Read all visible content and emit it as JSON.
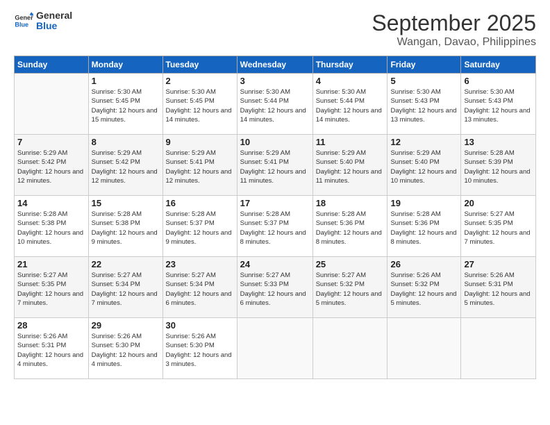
{
  "logo": {
    "line1": "General",
    "line2": "Blue"
  },
  "header": {
    "month": "September 2025",
    "location": "Wangan, Davao, Philippines"
  },
  "weekdays": [
    "Sunday",
    "Monday",
    "Tuesday",
    "Wednesday",
    "Thursday",
    "Friday",
    "Saturday"
  ],
  "weeks": [
    [
      {
        "day": "",
        "info": ""
      },
      {
        "day": "1",
        "info": "Sunrise: 5:30 AM\nSunset: 5:45 PM\nDaylight: 12 hours\nand 15 minutes."
      },
      {
        "day": "2",
        "info": "Sunrise: 5:30 AM\nSunset: 5:45 PM\nDaylight: 12 hours\nand 14 minutes."
      },
      {
        "day": "3",
        "info": "Sunrise: 5:30 AM\nSunset: 5:44 PM\nDaylight: 12 hours\nand 14 minutes."
      },
      {
        "day": "4",
        "info": "Sunrise: 5:30 AM\nSunset: 5:44 PM\nDaylight: 12 hours\nand 14 minutes."
      },
      {
        "day": "5",
        "info": "Sunrise: 5:30 AM\nSunset: 5:43 PM\nDaylight: 12 hours\nand 13 minutes."
      },
      {
        "day": "6",
        "info": "Sunrise: 5:30 AM\nSunset: 5:43 PM\nDaylight: 12 hours\nand 13 minutes."
      }
    ],
    [
      {
        "day": "7",
        "info": "Sunrise: 5:29 AM\nSunset: 5:42 PM\nDaylight: 12 hours\nand 12 minutes."
      },
      {
        "day": "8",
        "info": "Sunrise: 5:29 AM\nSunset: 5:42 PM\nDaylight: 12 hours\nand 12 minutes."
      },
      {
        "day": "9",
        "info": "Sunrise: 5:29 AM\nSunset: 5:41 PM\nDaylight: 12 hours\nand 12 minutes."
      },
      {
        "day": "10",
        "info": "Sunrise: 5:29 AM\nSunset: 5:41 PM\nDaylight: 12 hours\nand 11 minutes."
      },
      {
        "day": "11",
        "info": "Sunrise: 5:29 AM\nSunset: 5:40 PM\nDaylight: 12 hours\nand 11 minutes."
      },
      {
        "day": "12",
        "info": "Sunrise: 5:29 AM\nSunset: 5:40 PM\nDaylight: 12 hours\nand 10 minutes."
      },
      {
        "day": "13",
        "info": "Sunrise: 5:28 AM\nSunset: 5:39 PM\nDaylight: 12 hours\nand 10 minutes."
      }
    ],
    [
      {
        "day": "14",
        "info": "Sunrise: 5:28 AM\nSunset: 5:38 PM\nDaylight: 12 hours\nand 10 minutes."
      },
      {
        "day": "15",
        "info": "Sunrise: 5:28 AM\nSunset: 5:38 PM\nDaylight: 12 hours\nand 9 minutes."
      },
      {
        "day": "16",
        "info": "Sunrise: 5:28 AM\nSunset: 5:37 PM\nDaylight: 12 hours\nand 9 minutes."
      },
      {
        "day": "17",
        "info": "Sunrise: 5:28 AM\nSunset: 5:37 PM\nDaylight: 12 hours\nand 8 minutes."
      },
      {
        "day": "18",
        "info": "Sunrise: 5:28 AM\nSunset: 5:36 PM\nDaylight: 12 hours\nand 8 minutes."
      },
      {
        "day": "19",
        "info": "Sunrise: 5:28 AM\nSunset: 5:36 PM\nDaylight: 12 hours\nand 8 minutes."
      },
      {
        "day": "20",
        "info": "Sunrise: 5:27 AM\nSunset: 5:35 PM\nDaylight: 12 hours\nand 7 minutes."
      }
    ],
    [
      {
        "day": "21",
        "info": "Sunrise: 5:27 AM\nSunset: 5:35 PM\nDaylight: 12 hours\nand 7 minutes."
      },
      {
        "day": "22",
        "info": "Sunrise: 5:27 AM\nSunset: 5:34 PM\nDaylight: 12 hours\nand 7 minutes."
      },
      {
        "day": "23",
        "info": "Sunrise: 5:27 AM\nSunset: 5:34 PM\nDaylight: 12 hours\nand 6 minutes."
      },
      {
        "day": "24",
        "info": "Sunrise: 5:27 AM\nSunset: 5:33 PM\nDaylight: 12 hours\nand 6 minutes."
      },
      {
        "day": "25",
        "info": "Sunrise: 5:27 AM\nSunset: 5:32 PM\nDaylight: 12 hours\nand 5 minutes."
      },
      {
        "day": "26",
        "info": "Sunrise: 5:26 AM\nSunset: 5:32 PM\nDaylight: 12 hours\nand 5 minutes."
      },
      {
        "day": "27",
        "info": "Sunrise: 5:26 AM\nSunset: 5:31 PM\nDaylight: 12 hours\nand 5 minutes."
      }
    ],
    [
      {
        "day": "28",
        "info": "Sunrise: 5:26 AM\nSunset: 5:31 PM\nDaylight: 12 hours\nand 4 minutes."
      },
      {
        "day": "29",
        "info": "Sunrise: 5:26 AM\nSunset: 5:30 PM\nDaylight: 12 hours\nand 4 minutes."
      },
      {
        "day": "30",
        "info": "Sunrise: 5:26 AM\nSunset: 5:30 PM\nDaylight: 12 hours\nand 3 minutes."
      },
      {
        "day": "",
        "info": ""
      },
      {
        "day": "",
        "info": ""
      },
      {
        "day": "",
        "info": ""
      },
      {
        "day": "",
        "info": ""
      }
    ]
  ]
}
